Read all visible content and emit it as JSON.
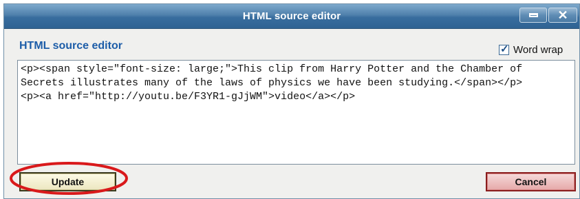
{
  "window": {
    "title": "HTML source editor",
    "minimize_icon": "minimize-icon",
    "close_icon": "close-icon"
  },
  "editor": {
    "heading": "HTML source editor",
    "word_wrap": {
      "label": "Word wrap",
      "checked": true
    },
    "source_text": "<p><span style=\"font-size: large;\">This clip from Harry Potter and the Chamber of Secrets illustrates many of the laws of physics we have been studying.</span></p>\n<p><a href=\"http://youtu.be/F3YR1-gJjWM\">video</a></p>"
  },
  "actions": {
    "update_label": "Update",
    "cancel_label": "Cancel"
  },
  "annotation": {
    "highlight_color": "#d9191b",
    "highlight_target": "update-button"
  },
  "colors": {
    "titlebar": "#4f80ac",
    "heading": "#1d5da8",
    "update_border": "#3a3a1e",
    "cancel_border": "#8a1d1d"
  }
}
